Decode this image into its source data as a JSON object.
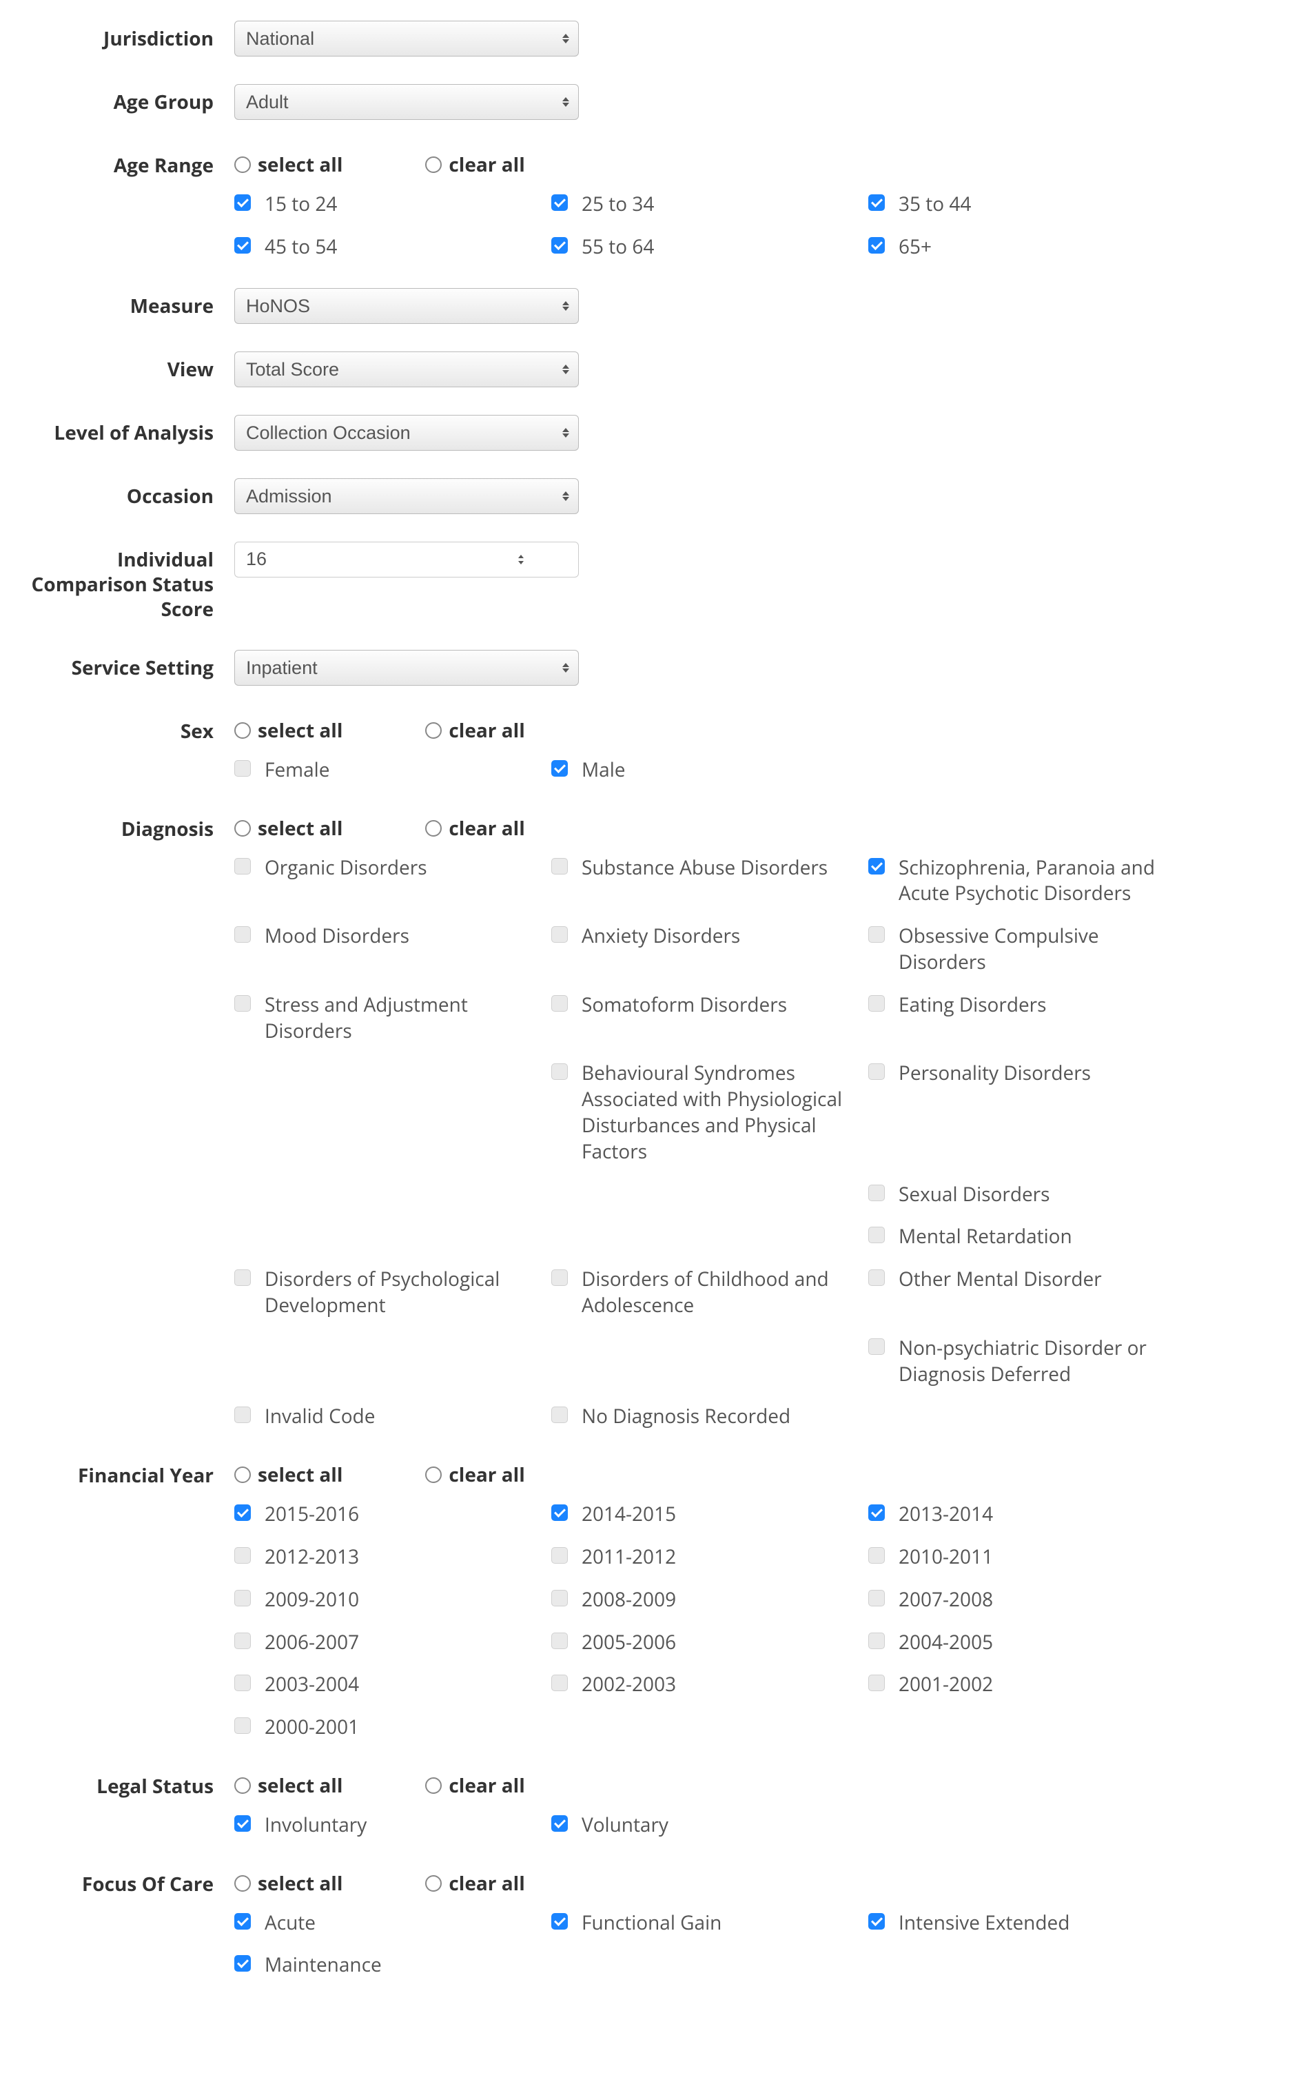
{
  "labels": {
    "jurisdiction": "Jurisdiction",
    "ageGroup": "Age Group",
    "ageRange": "Age Range",
    "measure": "Measure",
    "view": "View",
    "levelOfAnalysis": "Level of Analysis",
    "occasion": "Occasion",
    "individualComparison": "Individual Comparison Status Score",
    "serviceSetting": "Service Setting",
    "sex": "Sex",
    "diagnosis": "Diagnosis",
    "financialYear": "Financial Year",
    "legalStatus": "Legal Status",
    "focusOfCare": "Focus Of Care",
    "selectAll": "select all",
    "clearAll": "clear all"
  },
  "selects": {
    "jurisdiction": "National",
    "ageGroup": "Adult",
    "measure": "HoNOS",
    "view": "Total Score",
    "levelOfAnalysis": "Collection Occasion",
    "occasion": "Admission",
    "serviceSetting": "Inpatient"
  },
  "spinner": {
    "individualComparison": "16"
  },
  "ageRange": [
    {
      "label": "15 to 24",
      "checked": true
    },
    {
      "label": "25 to 34",
      "checked": true
    },
    {
      "label": "35 to 44",
      "checked": true
    },
    {
      "label": "45 to 54",
      "checked": true
    },
    {
      "label": "55 to 64",
      "checked": true
    },
    {
      "label": "65+",
      "checked": true
    }
  ],
  "sex": [
    {
      "label": "Female",
      "checked": false
    },
    {
      "label": "Male",
      "checked": true
    }
  ],
  "diagnosis": [
    {
      "label": "Organic Disorders",
      "checked": false
    },
    {
      "label": "Substance Abuse Disorders",
      "checked": false
    },
    {
      "label": "Schizophrenia, Paranoia and Acute Psychotic Disorders",
      "checked": true
    },
    {
      "label": "Mood Disorders",
      "checked": false
    },
    {
      "label": "Anxiety Disorders",
      "checked": false
    },
    {
      "label": "Obsessive Compulsive Disorders",
      "checked": false
    },
    {
      "label": "Stress and Adjustment Disorders",
      "checked": false
    },
    {
      "label": "Somatoform Disorders",
      "checked": false
    },
    {
      "label": "Eating Disorders",
      "checked": false
    },
    {
      "label": "",
      "checked": false,
      "placeholder": true
    },
    {
      "label": "Behavioural Syndromes Associated with Physiological Disturbances and Physical Factors",
      "checked": false
    },
    {
      "label": "Personality Disorders",
      "checked": false
    },
    {
      "label": "",
      "checked": false,
      "placeholder": true
    },
    {
      "label": "",
      "checked": false,
      "placeholder": true
    },
    {
      "label": "Sexual Disorders",
      "checked": false
    },
    {
      "label": "",
      "checked": false,
      "placeholder": true
    },
    {
      "label": "",
      "checked": false,
      "placeholder": true
    },
    {
      "label": "Mental Retardation",
      "checked": false
    },
    {
      "label": "Disorders of Psychological Development",
      "checked": false
    },
    {
      "label": "Disorders of Childhood and Adolescence",
      "checked": false
    },
    {
      "label": "Other Mental Disorder",
      "checked": false
    },
    {
      "label": "",
      "checked": false,
      "placeholder": true
    },
    {
      "label": "",
      "checked": false,
      "placeholder": true
    },
    {
      "label": "Non-psychiatric Disorder or Diagnosis Deferred",
      "checked": false
    },
    {
      "label": "Invalid Code",
      "checked": false
    },
    {
      "label": "No Diagnosis Recorded",
      "checked": false
    }
  ],
  "financialYear": [
    {
      "label": "2015-2016",
      "checked": true
    },
    {
      "label": "2014-2015",
      "checked": true
    },
    {
      "label": "2013-2014",
      "checked": true
    },
    {
      "label": "2012-2013",
      "checked": false
    },
    {
      "label": "2011-2012",
      "checked": false
    },
    {
      "label": "2010-2011",
      "checked": false
    },
    {
      "label": "2009-2010",
      "checked": false
    },
    {
      "label": "2008-2009",
      "checked": false
    },
    {
      "label": "2007-2008",
      "checked": false
    },
    {
      "label": "2006-2007",
      "checked": false
    },
    {
      "label": "2005-2006",
      "checked": false
    },
    {
      "label": "2004-2005",
      "checked": false
    },
    {
      "label": "2003-2004",
      "checked": false
    },
    {
      "label": "2002-2003",
      "checked": false
    },
    {
      "label": "2001-2002",
      "checked": false
    },
    {
      "label": "2000-2001",
      "checked": false
    }
  ],
  "legalStatus": [
    {
      "label": "Involuntary",
      "checked": true
    },
    {
      "label": "Voluntary",
      "checked": true
    }
  ],
  "focusOfCare": [
    {
      "label": "Acute",
      "checked": true
    },
    {
      "label": "Functional Gain",
      "checked": true
    },
    {
      "label": "Intensive Extended",
      "checked": true
    },
    {
      "label": "Maintenance",
      "checked": true
    }
  ]
}
